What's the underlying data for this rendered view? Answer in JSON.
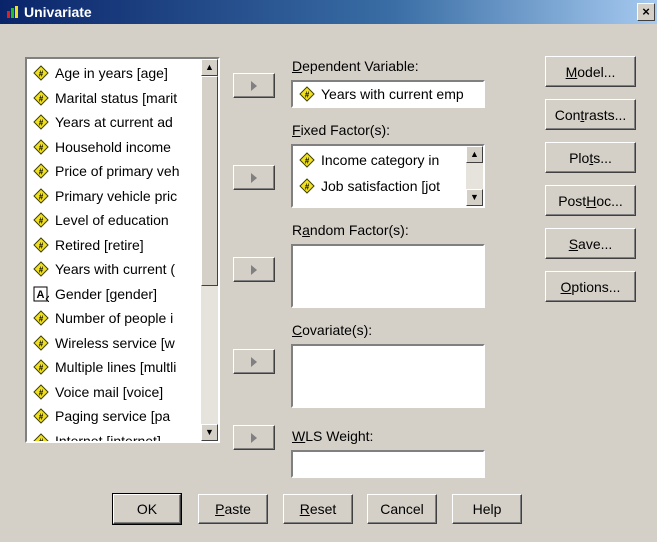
{
  "window": {
    "title": "Univariate",
    "close_label": "×"
  },
  "variables": [
    {
      "label": "Age in years [age]",
      "type": "scale"
    },
    {
      "label": "Marital status [marit",
      "type": "scale"
    },
    {
      "label": "Years at current ad",
      "type": "scale"
    },
    {
      "label": "Household income",
      "type": "scale"
    },
    {
      "label": "Price of primary veh",
      "type": "scale"
    },
    {
      "label": "Primary vehicle pric",
      "type": "scale"
    },
    {
      "label": "Level of education",
      "type": "scale"
    },
    {
      "label": "Retired [retire]",
      "type": "scale"
    },
    {
      "label": "Years with current (",
      "type": "scale"
    },
    {
      "label": "Gender [gender]",
      "type": "string"
    },
    {
      "label": "Number of people i",
      "type": "scale"
    },
    {
      "label": "Wireless service [w",
      "type": "scale"
    },
    {
      "label": "Multiple lines [multli",
      "type": "scale"
    },
    {
      "label": "Voice mail [voice]",
      "type": "scale"
    },
    {
      "label": "Paging service [pa",
      "type": "scale"
    },
    {
      "label": "Internet [internet]",
      "type": "scale"
    }
  ],
  "sections": {
    "dependent": {
      "label_u": "D",
      "label_rest": "ependent Variable:",
      "items": [
        "Years with current emp"
      ]
    },
    "fixed": {
      "label_u": "F",
      "label_rest": "ixed Factor(s):",
      "items": [
        "Income category in",
        "Job satisfaction [jot"
      ]
    },
    "random": {
      "label_pre": "R",
      "label_u": "a",
      "label_rest": "ndom Factor(s):"
    },
    "covariate": {
      "label_u": "C",
      "label_rest": "ovariate(s):"
    },
    "wls": {
      "label_u": "W",
      "label_rest": "LS Weight:"
    }
  },
  "side_buttons": {
    "model": {
      "u": "M",
      "rest": "odel..."
    },
    "contrasts": {
      "pre": "Con",
      "u": "t",
      "rest": "rasts..."
    },
    "plots": {
      "pre": "Plo",
      "u": "t",
      "rest": "s..."
    },
    "posthoc": {
      "pre": "Post ",
      "u": "H",
      "rest": "oc..."
    },
    "save": {
      "u": "S",
      "rest": "ave..."
    },
    "options": {
      "u": "O",
      "rest": "ptions..."
    }
  },
  "bottom_buttons": {
    "ok": "OK",
    "paste": {
      "u": "P",
      "rest": "aste"
    },
    "reset": {
      "u": "R",
      "rest": "eset"
    },
    "cancel": "Cancel",
    "help": "Help"
  }
}
